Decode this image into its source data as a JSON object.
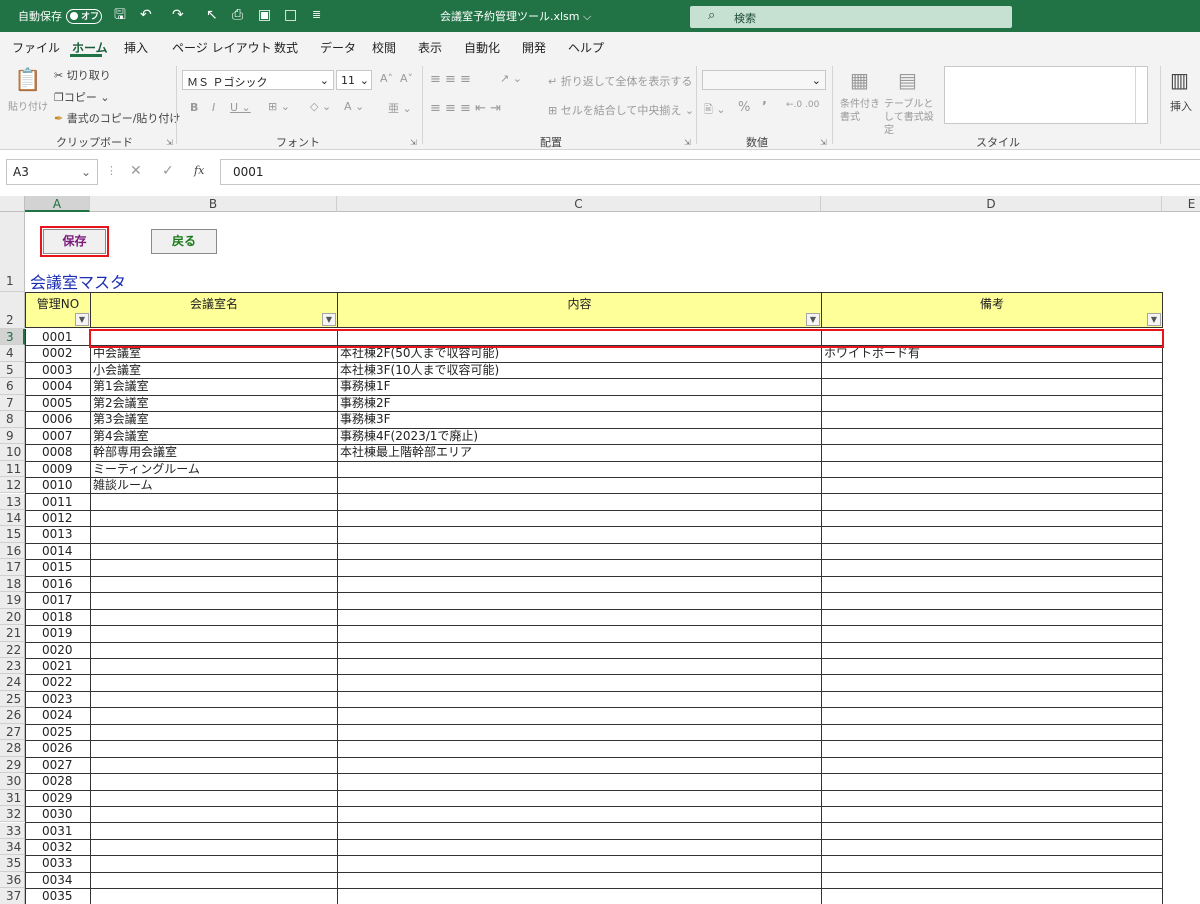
{
  "titlebar": {
    "autosave_label": "自動保存",
    "autosave_state": "オフ",
    "filename": "会議室予約管理ツール.xlsm",
    "search_placeholder": "検索"
  },
  "menu": [
    "ファイル",
    "ホーム",
    "挿入",
    "ページ レイアウト",
    "数式",
    "データ",
    "校閲",
    "表示",
    "自動化",
    "開発",
    "ヘルプ"
  ],
  "ribbon": {
    "clipboard": {
      "paste": "貼り付け",
      "cut": "切り取り",
      "copy": "コピー",
      "format_painter": "書式のコピー/貼り付け",
      "label": "クリップボード"
    },
    "font": {
      "name": "ＭＳ Ｐゴシック",
      "size": "11",
      "label": "フォント"
    },
    "alignment": {
      "wrap": "折り返して全体を表示する",
      "merge": "セルを結合して中央揃え",
      "label": "配置"
    },
    "number": {
      "label": "数値"
    },
    "styles": {
      "conditional": "条件付き書式",
      "table": "テーブルとして書式設定",
      "label": "スタイル"
    },
    "cells": {
      "insert": "挿入"
    }
  },
  "formula_bar": {
    "name_box": "A3",
    "formula": "0001",
    "fx": "fx"
  },
  "grid": {
    "columns": [
      "A",
      "B",
      "C",
      "D",
      "E"
    ],
    "title": "会議室マスタ",
    "buttons": {
      "save": "保存",
      "back": "戻る"
    },
    "headers": [
      "管理NO",
      "会議室名",
      "内容",
      "備考"
    ],
    "rows": [
      [
        "0001",
        "",
        "",
        ""
      ],
      [
        "0002",
        "中会議室",
        "本社棟2F(50人まで収容可能)",
        "ホワイトボード有"
      ],
      [
        "0003",
        "小会議室",
        "本社棟3F(10人まで収容可能)",
        ""
      ],
      [
        "0004",
        "第1会議室",
        "事務棟1F",
        ""
      ],
      [
        "0005",
        "第2会議室",
        "事務棟2F",
        ""
      ],
      [
        "0006",
        "第3会議室",
        "事務棟3F",
        ""
      ],
      [
        "0007",
        "第4会議室",
        "事務棟4F(2023/1で廃止)",
        ""
      ],
      [
        "0008",
        "幹部専用会議室",
        "本社棟最上階幹部エリア",
        ""
      ],
      [
        "0009",
        "ミーティングルーム",
        "",
        ""
      ],
      [
        "0010",
        "雑談ルーム",
        "",
        ""
      ],
      [
        "0011",
        "",
        "",
        ""
      ],
      [
        "0012",
        "",
        "",
        ""
      ],
      [
        "0013",
        "",
        "",
        ""
      ],
      [
        "0014",
        "",
        "",
        ""
      ],
      [
        "0015",
        "",
        "",
        ""
      ],
      [
        "0016",
        "",
        "",
        ""
      ],
      [
        "0017",
        "",
        "",
        ""
      ],
      [
        "0018",
        "",
        "",
        ""
      ],
      [
        "0019",
        "",
        "",
        ""
      ],
      [
        "0020",
        "",
        "",
        ""
      ],
      [
        "0021",
        "",
        "",
        ""
      ],
      [
        "0022",
        "",
        "",
        ""
      ],
      [
        "0023",
        "",
        "",
        ""
      ],
      [
        "0024",
        "",
        "",
        ""
      ],
      [
        "0025",
        "",
        "",
        ""
      ],
      [
        "0026",
        "",
        "",
        ""
      ],
      [
        "0027",
        "",
        "",
        ""
      ],
      [
        "0028",
        "",
        "",
        ""
      ],
      [
        "0029",
        "",
        "",
        ""
      ],
      [
        "0030",
        "",
        "",
        ""
      ],
      [
        "0031",
        "",
        "",
        ""
      ],
      [
        "0032",
        "",
        "",
        ""
      ],
      [
        "0033",
        "",
        "",
        ""
      ],
      [
        "0034",
        "",
        "",
        ""
      ],
      [
        "0035",
        "",
        "",
        ""
      ]
    ]
  },
  "colors": {
    "excel_green": "#217346",
    "header_yellow": "#ffff99",
    "highlight_red": "#e8141c",
    "title_blue": "#1a2db3"
  }
}
